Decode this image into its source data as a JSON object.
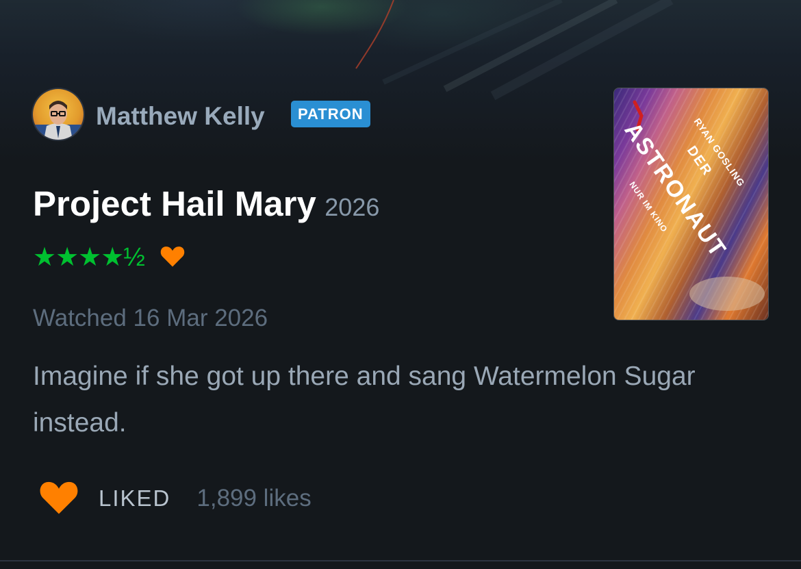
{
  "review": {
    "author": {
      "name": "Matthew Kelly",
      "badge": "PATRON"
    },
    "film": {
      "title": "Project Hail Mary",
      "year": "2026"
    },
    "rating": {
      "stars": "★★★★½",
      "value": 4.5,
      "max": 5,
      "liked_icon": "heart-icon"
    },
    "watched": "Watched 16 Mar 2026",
    "text": "Imagine if she got up there and sang Watermelon Sugar instead.",
    "footer": {
      "liked_label": "LIKED",
      "likes": "1,899 likes"
    },
    "poster": {
      "actor": "RYAN GOSLING",
      "title_top": "DER",
      "title": "ASTRONAUT",
      "tagline": "NUR IM KINO"
    }
  },
  "colors": {
    "background": "#14181c",
    "green_stars": "#00c030",
    "orange_heart": "#ff8000",
    "patron_blue": "#2a8fd3",
    "name_grey": "#99aabb"
  }
}
